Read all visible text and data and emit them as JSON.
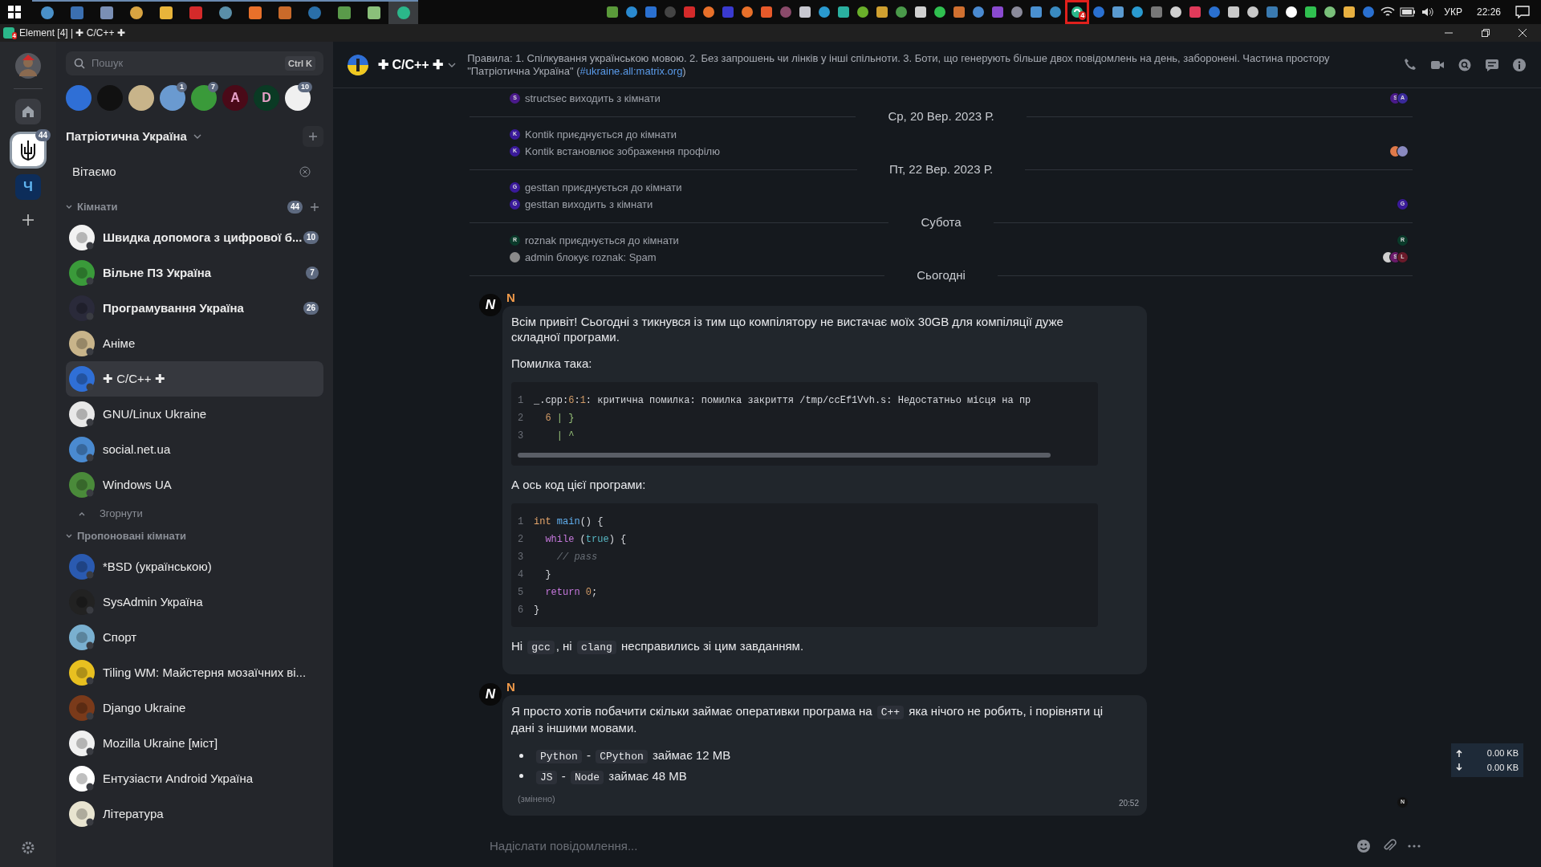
{
  "taskbar": {
    "apps": [
      {
        "color": "#4a90c8",
        "selected": false
      },
      {
        "color": "#3b6fb0",
        "selected": false
      },
      {
        "color": "#7a8fb5",
        "selected": false
      },
      {
        "color": "#d9a441",
        "selected": false
      },
      {
        "color": "#e8b43a",
        "selected": false
      },
      {
        "color": "#d42a2a",
        "selected": false
      },
      {
        "color": "#5a8fa8",
        "selected": false
      },
      {
        "color": "#e8702a",
        "selected": false
      },
      {
        "color": "#c96a2a",
        "selected": false
      },
      {
        "color": "#2a6fa8",
        "selected": false
      },
      {
        "color": "#5a9a4a",
        "selected": false
      },
      {
        "color": "#8ac07a",
        "selected": false
      },
      {
        "color": "#2bb78a",
        "selected": true
      }
    ],
    "element_tray": {
      "badge": "4",
      "highlighted": true
    },
    "language": "УКР",
    "clock": "22:26"
  },
  "window": {
    "title": "Element [4] | ✚ C/C++ ✚",
    "icon_badge": "4"
  },
  "spaces": [
    {
      "kind": "logo",
      "badge": "44",
      "selected": true
    },
    {
      "kind": "letter",
      "letter": "Ч",
      "selected": false
    }
  ],
  "search": {
    "placeholder": "Пошук",
    "shortcut": "Ctrl K"
  },
  "breadcrumbs": [
    {
      "color": "#2f6fd6"
    },
    {
      "color": "#111111"
    },
    {
      "color": "#c8b48a"
    },
    {
      "color": "#6a9ad0",
      "badge": "1"
    },
    {
      "color": "#3a9a3a",
      "badge": "7"
    },
    {
      "color": "#4a0a18",
      "letter": "A"
    },
    {
      "color": "#0a3a24",
      "letter": "D"
    },
    {
      "color": "#f0f0f0",
      "badge": "10"
    }
  ],
  "space_name": "Патріотична Україна",
  "welcome": "Вітаємо",
  "rooms_section": {
    "title": "Кімнати",
    "badge": "44",
    "expanded": true
  },
  "rooms": [
    {
      "name": "Швидка допомога з цифрової б...",
      "color": "#f2f2f2",
      "unread": true,
      "badge": "10",
      "selected": false
    },
    {
      "name": "Вільне ПЗ Україна",
      "color": "#3a9a3a",
      "unread": true,
      "badge": "7",
      "selected": false
    },
    {
      "name": "Програмування Україна",
      "color": "#2a2a3a",
      "unread": true,
      "badge": "26",
      "selected": false
    },
    {
      "name": "Аніме",
      "color": "#c8b48a",
      "unread": false,
      "selected": false
    },
    {
      "name": "✚ C/C++ ✚",
      "color": "#2f6fd6",
      "unread": false,
      "selected": true
    },
    {
      "name": "GNU/Linux Ukraine",
      "color": "#e8e8e8",
      "unread": false,
      "selected": false
    },
    {
      "name": "social.net.ua",
      "color": "#4a8ad0",
      "unread": false,
      "selected": false
    },
    {
      "name": "Windows UA",
      "color": "#4a8a3a",
      "unread": false,
      "selected": false
    }
  ],
  "collapse_label": "Згорнути",
  "suggested_section": {
    "title": "Пропоновані кімнати",
    "expanded": true
  },
  "suggested_rooms": [
    {
      "name": "*BSD (українською)",
      "color": "#2a5ab0"
    },
    {
      "name": "SysAdmin Україна",
      "color": "#222222"
    },
    {
      "name": "Спорт",
      "color": "#7ab0d0"
    },
    {
      "name": "Tiling WM: Майстерня мозаїчних ві...",
      "color": "#e8c020"
    },
    {
      "name": "Django Ukraine",
      "color": "#7a3a1a"
    },
    {
      "name": "Mozilla Ukraine [міст]",
      "color": "#f0f0f0"
    },
    {
      "name": "Ентузіасти Android Україна",
      "color": "#ffffff"
    },
    {
      "name": "Література",
      "color": "#e8e4d0"
    }
  ],
  "room_header": {
    "name": "✚ C/C++ ✚",
    "topic": "Правила: 1. Спілкування українською мовою. 2. Без запрошень чи лінків у інші спільноти. 3. Боти, що генерують більше двох повідомлень на день, заборонені. Частина простору \"Патріотична Україна\" (",
    "topic_link": "#ukraine.all:matrix.org",
    "topic_end": ")"
  },
  "timeline": [
    {
      "kind": "event",
      "avatar": {
        "letter": "S",
        "color": "#4a1a8a"
      },
      "text": "structsec виходить з кімнати",
      "receipts": [
        {
          "letter": "S",
          "color": "#4a1a8a"
        },
        {
          "letter": "A",
          "color": "#3a2a9a"
        }
      ]
    },
    {
      "kind": "date",
      "label": "Ср, 20 Вер. 2023 Р."
    },
    {
      "kind": "event",
      "avatar": {
        "letter": "K",
        "color": "#3a1a9a"
      },
      "text": "Kontik приєднується до кімнати"
    },
    {
      "kind": "event",
      "avatar": {
        "letter": "K",
        "color": "#3a1a9a"
      },
      "text": "Kontik встановлює зображення профілю",
      "receipts": [
        {
          "color": "#e07a4a"
        },
        {
          "color": "#8a8ac0"
        }
      ]
    },
    {
      "kind": "date",
      "label": "Пт, 22 Вер. 2023 Р."
    },
    {
      "kind": "event",
      "avatar": {
        "letter": "G",
        "color": "#3a1a9a"
      },
      "text": "gesttan приєднується до кімнати"
    },
    {
      "kind": "event",
      "avatar": {
        "letter": "G",
        "color": "#3a1a9a"
      },
      "text": "gesttan виходить з кімнати",
      "receipts": [
        {
          "letter": "G",
          "color": "#3a1a9a"
        }
      ]
    },
    {
      "kind": "date",
      "label": "Субота"
    },
    {
      "kind": "event",
      "avatar": {
        "letter": "R",
        "color": "#0a3a2a"
      },
      "text": "roznak приєднується до кімнати",
      "receipts": [
        {
          "letter": "R",
          "color": "#0a3a2a"
        }
      ]
    },
    {
      "kind": "event",
      "avatar": {
        "color": "#8a8a8a"
      },
      "text": "admin блокує roznak: Spam",
      "receipts": [
        {
          "color": "#d0d0d0"
        },
        {
          "letter": "S",
          "color": "#6a1a6a"
        },
        {
          "letter": "L",
          "color": "#6a1a2a"
        }
      ]
    },
    {
      "kind": "date",
      "label": "Сьогодні"
    },
    {
      "kind": "message",
      "sender": "N",
      "avatar_letter": "N",
      "blocks": [
        {
          "kind": "paragraph",
          "parts": [
            {
              "kind": "text",
              "text": "Всім привіт! Сьогодні з тикнувся із тим що компілятору не вистачає моїх 30GB для компіляції дуже складної програми."
            }
          ]
        },
        {
          "kind": "paragraph",
          "parts": [
            {
              "kind": "text",
              "text": "Помилка така:"
            }
          ]
        },
        {
          "kind": "code_block",
          "scrollable": true,
          "lines": [
            {
              "number": "1",
              "tokens": [
                {
                  "kind": "plain",
                  "text": "_.cpp:"
                },
                {
                  "kind": "number",
                  "text": "6"
                },
                {
                  "kind": "plain",
                  "text": ":"
                },
                {
                  "kind": "number",
                  "text": "1"
                },
                {
                  "kind": "plain",
                  "text": ": критична помилка: помилка закриття /tmp/ccEf1Vvh.s: Недостатньо місця на пр"
                }
              ]
            },
            {
              "number": "2",
              "tokens": [
                {
                  "kind": "number",
                  "text": "  6"
                },
                {
                  "kind": "gutter",
                  "text": " | }"
                }
              ]
            },
            {
              "number": "3",
              "tokens": [
                {
                  "kind": "gutter",
                  "text": "    | ^"
                }
              ]
            }
          ]
        },
        {
          "kind": "paragraph",
          "parts": [
            {
              "kind": "text",
              "text": "А ось код цієї програми:"
            }
          ]
        },
        {
          "kind": "code_block",
          "scrollable": false,
          "lines": [
            {
              "number": "1",
              "tokens": [
                {
                  "kind": "type",
                  "text": "int"
                },
                {
                  "kind": "function",
                  "text": " main"
                },
                {
                  "kind": "plain",
                  "text": "() {"
                }
              ]
            },
            {
              "number": "2",
              "tokens": [
                {
                  "kind": "keyword",
                  "text": "  while"
                },
                {
                  "kind": "plain",
                  "text": " ("
                },
                {
                  "kind": "literal",
                  "text": "true"
                },
                {
                  "kind": "plain",
                  "text": ") {"
                }
              ]
            },
            {
              "number": "3",
              "tokens": [
                {
                  "kind": "comment",
                  "text": "    // pass"
                }
              ]
            },
            {
              "number": "4",
              "tokens": [
                {
                  "kind": "plain",
                  "text": "  }"
                }
              ]
            },
            {
              "number": "5",
              "tokens": [
                {
                  "kind": "keyword",
                  "text": "  return"
                },
                {
                  "kind": "number",
                  "text": " 0"
                },
                {
                  "kind": "plain",
                  "text": ";"
                }
              ]
            },
            {
              "number": "6",
              "tokens": [
                {
                  "kind": "plain",
                  "text": "}"
                }
              ]
            }
          ]
        },
        {
          "kind": "paragraph",
          "parts": [
            {
              "kind": "text",
              "text": "Ні "
            },
            {
              "kind": "code",
              "text": "gcc"
            },
            {
              "kind": "text",
              "text": ", ні "
            },
            {
              "kind": "code",
              "text": "clang"
            },
            {
              "kind": "text",
              "text": " несправились зі цим завданням."
            }
          ]
        }
      ]
    },
    {
      "kind": "message",
      "sender": "N",
      "avatar_letter": "N",
      "blocks": [
        {
          "kind": "paragraph",
          "parts": [
            {
              "kind": "text",
              "text": "Я просто хотів побачити скільки займає оперативки програма на "
            },
            {
              "kind": "code",
              "text": "C++"
            },
            {
              "kind": "text",
              "text": " яка нічого не робить, і порівняти ці дані з іншими мовами."
            }
          ]
        },
        {
          "kind": "list",
          "items": [
            {
              "parts": [
                {
                  "kind": "code",
                  "text": "Python"
                },
                {
                  "kind": "text",
                  "text": " - "
                },
                {
                  "kind": "code",
                  "text": "CPython"
                },
                {
                  "kind": "text",
                  "text": " займає 12 MB"
                }
              ]
            },
            {
              "parts": [
                {
                  "kind": "code",
                  "text": "JS"
                },
                {
                  "kind": "text",
                  "text": " - "
                },
                {
                  "kind": "code",
                  "text": "Node"
                },
                {
                  "kind": "text",
                  "text": " займає 48 MB"
                }
              ]
            }
          ]
        }
      ],
      "edited": "(змінено)",
      "time": "20:52",
      "receipts": [
        {
          "letter": "N",
          "color": "#111111"
        }
      ]
    }
  ],
  "composer": {
    "placeholder": "Надіслати повідомлення..."
  },
  "net_meter": {
    "up": "0.00 KB",
    "down": "0.00 KB"
  }
}
